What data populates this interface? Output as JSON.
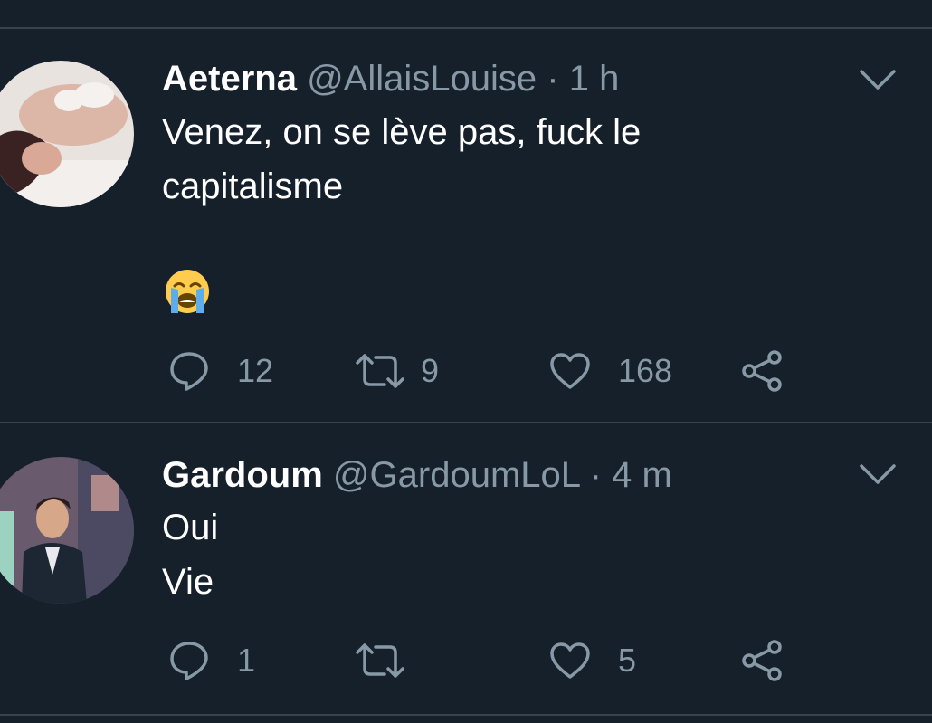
{
  "tweets": [
    {
      "name": "Aeterna",
      "handle": "@AllaisLouise",
      "separator": "·",
      "time": "1 h",
      "text_lines": [
        "Venez, on se lève pas, fuck le",
        "capitalisme"
      ],
      "emoji": "loudly-crying-face",
      "replies": "12",
      "retweets": "9",
      "likes": "168"
    },
    {
      "name": "Gardoum",
      "handle": "@GardoumLoL",
      "separator": "·",
      "time": "4 m",
      "text_lines": [
        "Oui",
        "Vie"
      ],
      "replies": "1",
      "retweets": "",
      "likes": "5"
    }
  ],
  "icons": {
    "reply": "reply-bubble-icon",
    "retweet": "retweet-icon",
    "like": "heart-icon",
    "share": "share-icon",
    "menu": "chevron-down-icon"
  },
  "colors": {
    "background": "#15202b",
    "divider": "#38444d",
    "secondary_text": "#8899a6",
    "primary_text": "#ffffff"
  }
}
